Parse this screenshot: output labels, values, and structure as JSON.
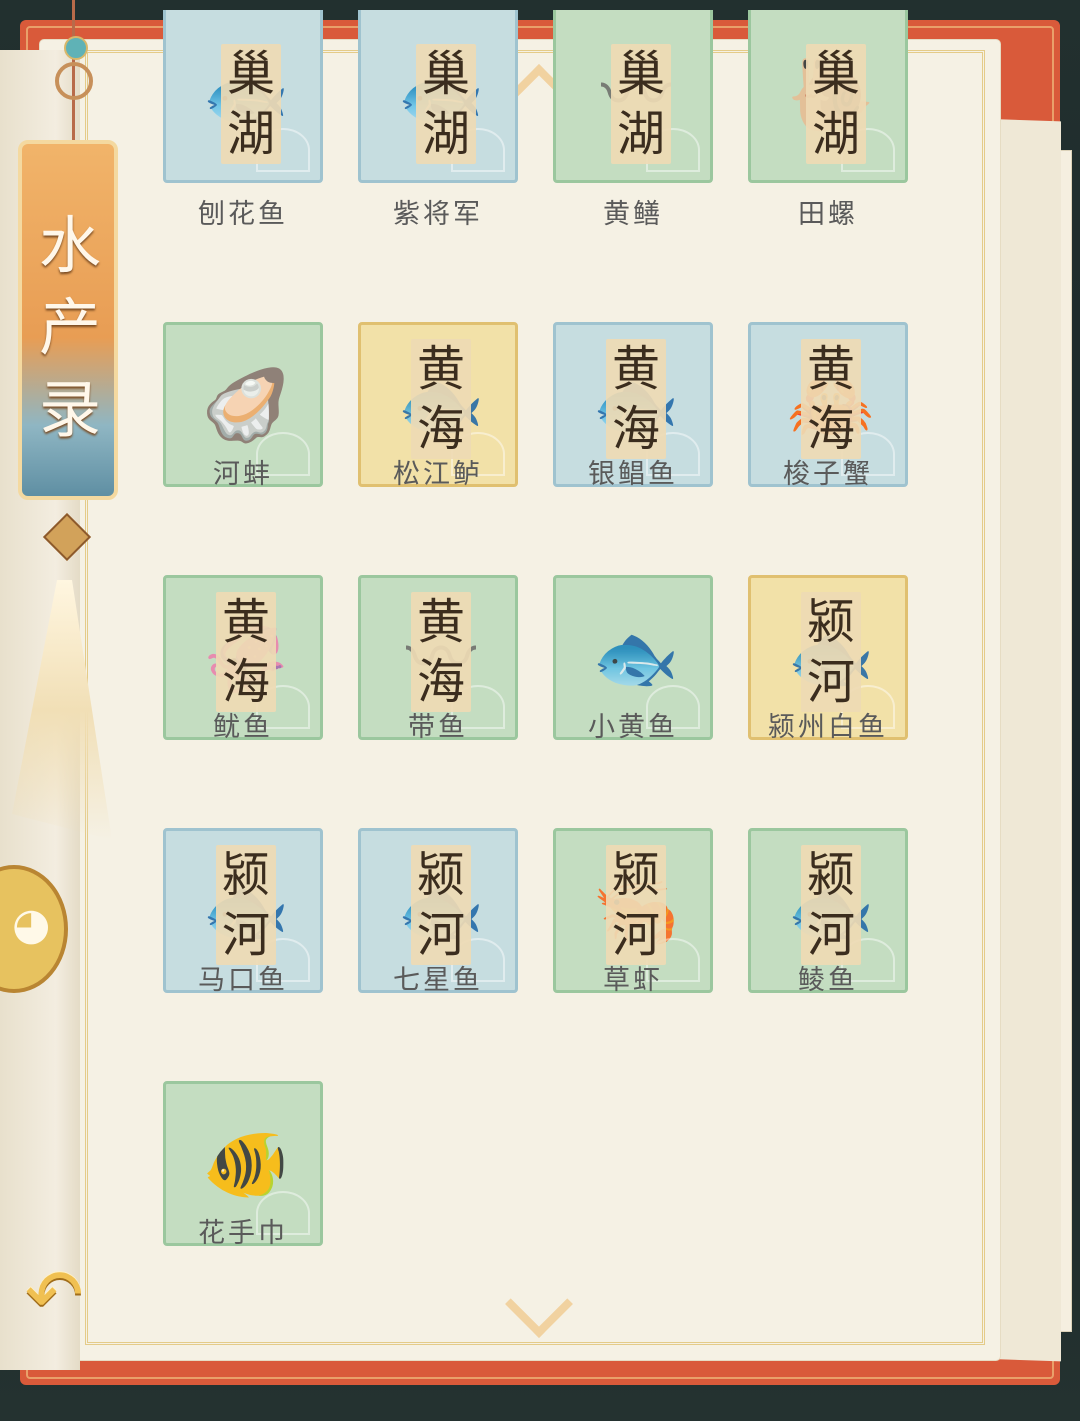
{
  "side_tab": {
    "title": "水产录"
  },
  "grid": {
    "cells": [
      {
        "name": "刨花鱼",
        "badge": [
          "巢",
          "湖"
        ],
        "bg": "blue",
        "icon": "fish-icon",
        "glyph": "🐟",
        "clip": true
      },
      {
        "name": "紫将军",
        "badge": [
          "巢",
          "湖"
        ],
        "bg": "blue",
        "icon": "fish-icon",
        "glyph": "🐟",
        "clip": true
      },
      {
        "name": "黄鳝",
        "badge": [
          "巢",
          "湖"
        ],
        "bg": "green",
        "icon": "eel-icon",
        "glyph": "〰",
        "clip": true
      },
      {
        "name": "田螺",
        "badge": [
          "巢",
          "湖"
        ],
        "bg": "green",
        "icon": "snail-icon",
        "glyph": "🐌",
        "clip": true
      },
      {
        "name": "河蚌",
        "badge": [],
        "bg": "green",
        "icon": "clam-icon",
        "glyph": "🦪",
        "clip": false
      },
      {
        "name": "松江鲈",
        "badge": [
          "黄",
          "海"
        ],
        "bg": "gold",
        "icon": "fish-icon",
        "glyph": "🐟",
        "clip": false
      },
      {
        "name": "银鲳鱼",
        "badge": [
          "黄",
          "海"
        ],
        "bg": "blue",
        "icon": "fish-icon",
        "glyph": "🐟",
        "clip": false
      },
      {
        "name": "梭子蟹",
        "badge": [
          "黄",
          "海"
        ],
        "bg": "blue",
        "icon": "crab-icon",
        "glyph": "🦀",
        "clip": false
      },
      {
        "name": "鱿鱼",
        "badge": [
          "黄",
          "海"
        ],
        "bg": "green",
        "icon": "squid-icon",
        "glyph": "🦑",
        "clip": false
      },
      {
        "name": "带鱼",
        "badge": [
          "黄",
          "海"
        ],
        "bg": "green",
        "icon": "ribbonfish-icon",
        "glyph": "〰",
        "clip": false
      },
      {
        "name": "小黄鱼",
        "badge": [],
        "bg": "green",
        "icon": "fish-icon",
        "glyph": "🐟",
        "clip": false
      },
      {
        "name": "颍州白鱼",
        "badge": [
          "颍",
          "河"
        ],
        "bg": "gold",
        "icon": "fish-icon",
        "glyph": "🐟",
        "clip": false
      },
      {
        "name": "马口鱼",
        "badge": [
          "颍",
          "河"
        ],
        "bg": "blue",
        "icon": "fish-icon",
        "glyph": "🐟",
        "clip": false
      },
      {
        "name": "七星鱼",
        "badge": [
          "颍",
          "河"
        ],
        "bg": "blue",
        "icon": "fish-icon",
        "glyph": "🐟",
        "clip": false
      },
      {
        "name": "草虾",
        "badge": [
          "颍",
          "河"
        ],
        "bg": "green",
        "icon": "shrimp-icon",
        "glyph": "🦐",
        "clip": false
      },
      {
        "name": "鲮鱼",
        "badge": [
          "颍",
          "河"
        ],
        "bg": "green",
        "icon": "fish-icon",
        "glyph": "🐟",
        "clip": false
      },
      {
        "name": "花手巾",
        "badge": [],
        "bg": "green",
        "icon": "fish-icon",
        "glyph": "🐠",
        "clip": false
      }
    ]
  },
  "colors": {
    "cover": "#d95a3a",
    "page": "#f5f1e4",
    "accent_gold": "#f0c052"
  }
}
